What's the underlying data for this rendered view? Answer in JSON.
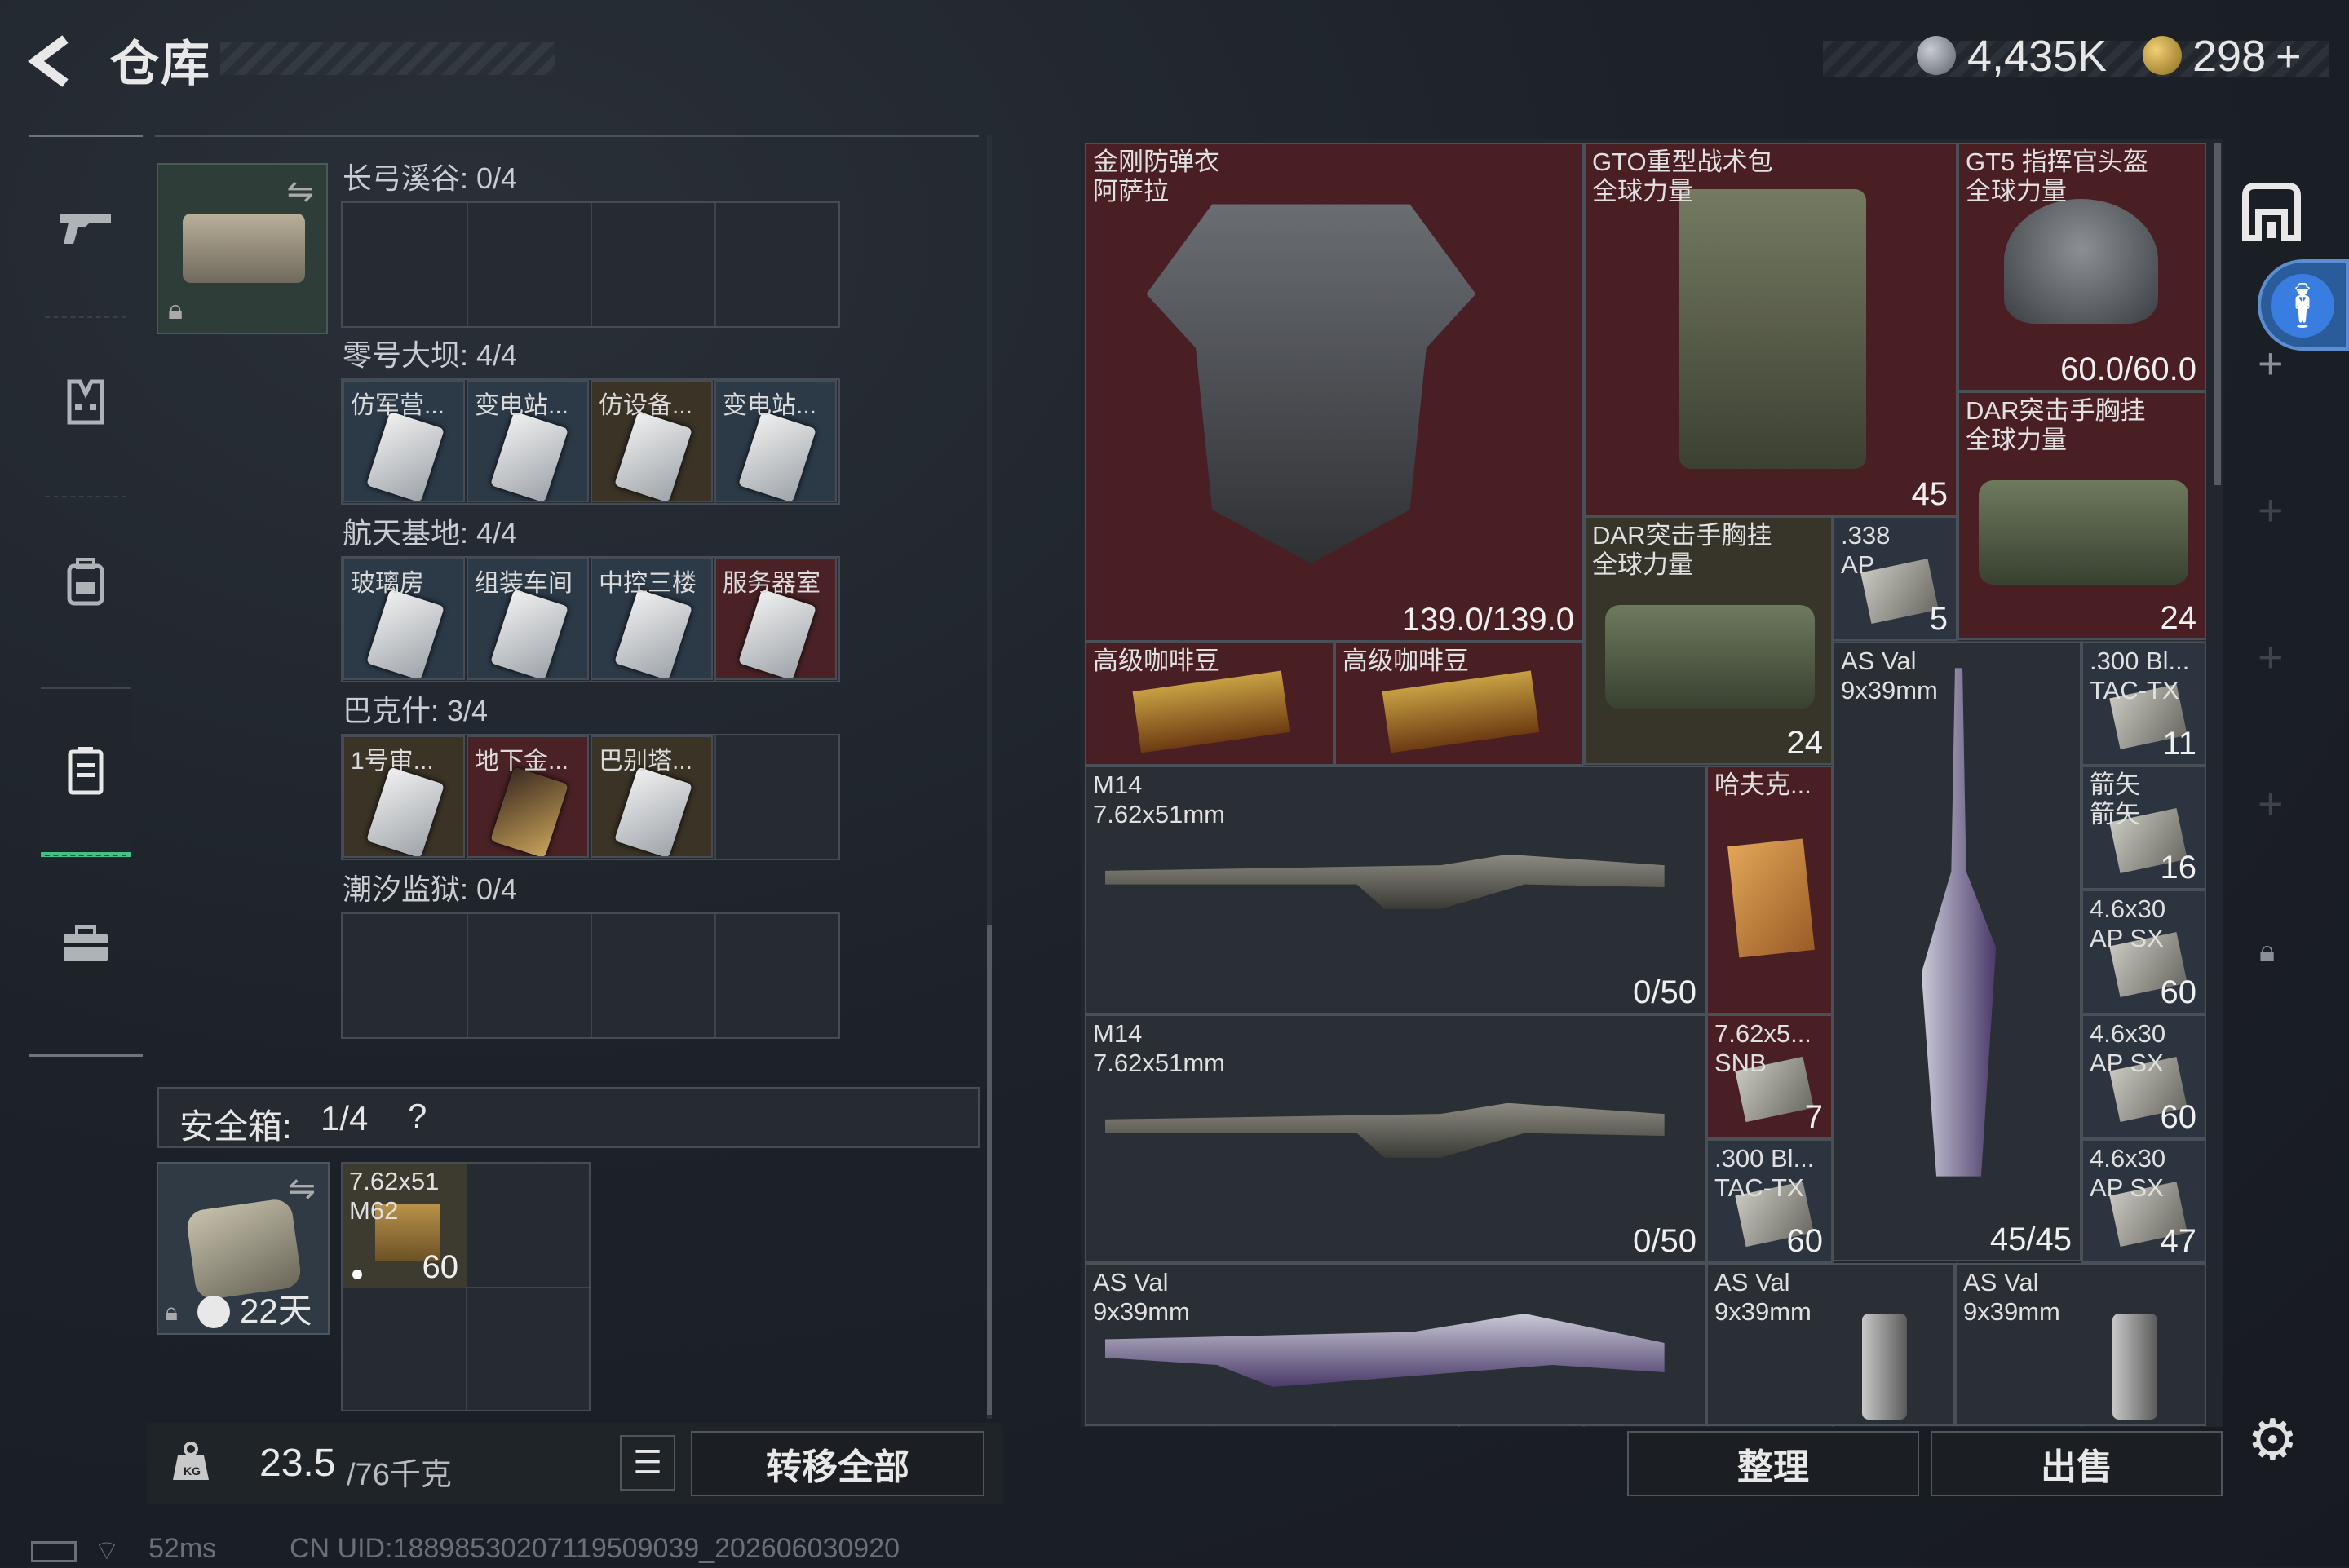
{
  "header": {
    "title": "仓库",
    "currency1": "4,435K",
    "currency2": "298",
    "currency2_plus": "+"
  },
  "left": {
    "sections": [
      {
        "title": "长弓溪谷: 0/4",
        "keys": []
      },
      {
        "title": "零号大坝: 4/4",
        "keys": [
          "仿军营...",
          "变电站...",
          "仿设备...",
          "变电站..."
        ]
      },
      {
        "title": "航天基地: 4/4",
        "keys": [
          "玻璃房",
          "组装车间",
          "中控三楼",
          "服务器室"
        ]
      },
      {
        "title": "巴克什: 3/4",
        "keys": [
          "1号审...",
          "地下金...",
          "巴别塔..."
        ]
      },
      {
        "title": "潮汐监狱: 0/4",
        "keys": []
      }
    ],
    "safebox": {
      "title": "安全箱:",
      "count": "1/4",
      "help": "?",
      "timer": "22天",
      "item_name": "7.62x51\nM62",
      "item_count": "60"
    },
    "weight": {
      "current": "23.5",
      "max": "/76千克"
    },
    "transfer_all": "转移全部"
  },
  "grid": {
    "items": [
      {
        "name": "金刚防弹衣\n阿萨拉",
        "value": "139.0/139.0"
      },
      {
        "name": "GTO重型战术包\n全球力量",
        "value": "45"
      },
      {
        "name": "GT5 指挥官头盔\n全球力量",
        "value": "60.0/60.0"
      },
      {
        "name": "DAR突击手胸挂\n全球力量",
        "value": "24"
      },
      {
        "name": "DAR突击手胸挂\n全球力量",
        "value": "24"
      },
      {
        "name": ".338\nAP",
        "value": "5"
      },
      {
        "name": "高级咖啡豆",
        "value": ""
      },
      {
        "name": "高级咖啡豆",
        "value": ""
      },
      {
        "name": "AS Val\n9x39mm",
        "value": "45/45"
      },
      {
        "name": ".300 Bl...\nTAC-TX",
        "value": "11"
      },
      {
        "name": "M14\n7.62x51mm",
        "value": "0/50"
      },
      {
        "name": "哈夫克...",
        "value": ""
      },
      {
        "name": "箭矢\n箭矢",
        "value": "16"
      },
      {
        "name": "4.6x30\nAP SX",
        "value": "60"
      },
      {
        "name": "M14\n7.62x51mm",
        "value": "0/50"
      },
      {
        "name": "7.62x5...\nSNB",
        "value": "7"
      },
      {
        "name": "4.6x30\nAP SX",
        "value": "60"
      },
      {
        "name": ".300 Bl...\nTAC-TX",
        "value": "60"
      },
      {
        "name": "4.6x30\nAP SX",
        "value": "47"
      },
      {
        "name": "AS Val\n9x39mm",
        "value": ""
      },
      {
        "name": "AS Val\n9x39mm",
        "value": ""
      },
      {
        "name": "AS Val\n9x39mm",
        "value": ""
      }
    ]
  },
  "actions": {
    "sort": "整理",
    "sell": "出售"
  },
  "status": {
    "ping": "52ms",
    "uid": "CN UID:1889853020711950903​9_202606030920"
  },
  "colors": {
    "accent": "#43c08a",
    "item_red": "#4a1f24",
    "item_green": "#37352a",
    "item_blue": "#2a3440"
  }
}
